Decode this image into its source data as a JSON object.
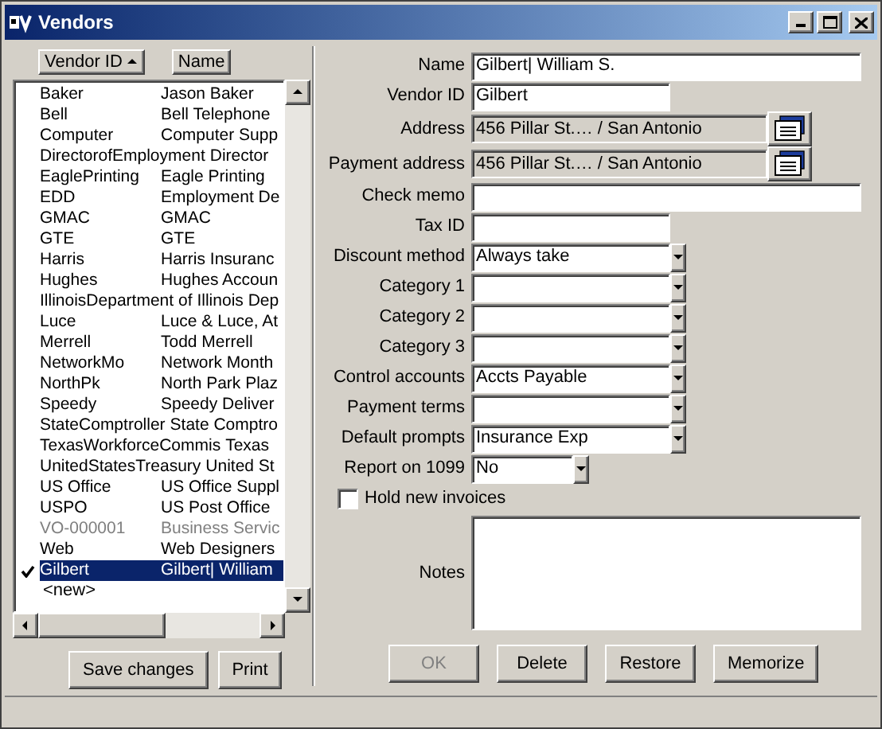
{
  "window": {
    "title": "Vendors"
  },
  "columns": [
    {
      "label": "Vendor ID",
      "sorted": true
    },
    {
      "label": "Name",
      "sorted": false
    }
  ],
  "vendors": [
    {
      "id": "Baker",
      "name": "Jason Baker",
      "inactive": false,
      "selected": false
    },
    {
      "id": "Bell",
      "name": "Bell Telephone",
      "inactive": false,
      "selected": false
    },
    {
      "id": "Computer",
      "name": "Computer Supp",
      "inactive": false,
      "selected": false
    },
    {
      "id": "DirectorofEmployment",
      "name": "Director",
      "inactive": false,
      "selected": false
    },
    {
      "id": "EaglePrinting",
      "name": "Eagle Printing",
      "inactive": false,
      "selected": false
    },
    {
      "id": "EDD",
      "name": "Employment De",
      "inactive": false,
      "selected": false
    },
    {
      "id": "GMAC",
      "name": "GMAC",
      "inactive": false,
      "selected": false
    },
    {
      "id": "GTE",
      "name": "GTE",
      "inactive": false,
      "selected": false
    },
    {
      "id": "Harris",
      "name": "Harris Insuranc",
      "inactive": false,
      "selected": false
    },
    {
      "id": "Hughes",
      "name": "Hughes Accoun",
      "inactive": false,
      "selected": false
    },
    {
      "id": "IllinoisDepartment",
      "name": "of Illinois Dep",
      "inactive": false,
      "selected": false
    },
    {
      "id": "Luce",
      "name": "Luce & Luce, At",
      "inactive": false,
      "selected": false
    },
    {
      "id": "Merrell",
      "name": "Todd Merrell",
      "inactive": false,
      "selected": false
    },
    {
      "id": "NetworkMo",
      "name": "Network Month",
      "inactive": false,
      "selected": false
    },
    {
      "id": "NorthPk",
      "name": "North Park Plaz",
      "inactive": false,
      "selected": false
    },
    {
      "id": "Speedy",
      "name": "Speedy Deliver",
      "inactive": false,
      "selected": false
    },
    {
      "id": "StateComptroller",
      "name": "State Comptro",
      "inactive": false,
      "selected": false
    },
    {
      "id": "TexasWorkforceCommis",
      "name": "Texas",
      "inactive": false,
      "selected": false
    },
    {
      "id": "UnitedStatesTreasury",
      "name": "United St",
      "inactive": false,
      "selected": false
    },
    {
      "id": "US Office",
      "name": "US Office Suppl",
      "inactive": false,
      "selected": false
    },
    {
      "id": "USPO",
      "name": "US Post Office",
      "inactive": false,
      "selected": false
    },
    {
      "id": "VO-000001",
      "name": "Business Servic",
      "inactive": true,
      "selected": false
    },
    {
      "id": "Web",
      "name": "Web Designers",
      "inactive": false,
      "selected": false
    },
    {
      "id": "Gilbert",
      "name": "Gilbert| William",
      "inactive": false,
      "selected": true
    }
  ],
  "new_entry": "<new>",
  "left_buttons": [
    {
      "label": "Save changes",
      "disabled": false
    },
    {
      "label": "Print",
      "disabled": false
    }
  ],
  "fields": [
    {
      "label": "Name",
      "kind": "wide",
      "value": "Gilbert| William S."
    },
    {
      "label": "Vendor ID",
      "kind": "narrow",
      "value": "Gilbert"
    },
    {
      "label": "Address",
      "kind": "address",
      "value": "456 Pillar St.… / San Antonio"
    },
    {
      "label": "Payment address",
      "kind": "address",
      "value": "456 Pillar St.… / San Antonio"
    },
    {
      "label": "Check memo",
      "kind": "wide"
    },
    {
      "label": "Tax ID",
      "kind": "narrow"
    },
    {
      "label": "Discount method",
      "kind": "combo",
      "value": "Always take"
    },
    {
      "label": "Category 1",
      "kind": "combo"
    },
    {
      "label": "Category 2",
      "kind": "combo"
    },
    {
      "label": "Category 3",
      "kind": "combo"
    },
    {
      "label": "Control accounts",
      "kind": "combo",
      "value": "Accts Payable"
    },
    {
      "label": "Payment terms",
      "kind": "combo"
    },
    {
      "label": "Default prompts",
      "kind": "combo",
      "value": "Insurance Exp"
    },
    {
      "label": "Report on 1099",
      "kind": "smallcombo",
      "value": "No"
    }
  ],
  "hold_invoices": {
    "label": "Hold new invoices",
    "checked": false
  },
  "notes": {
    "label": "Notes"
  },
  "buttons": [
    {
      "label": "OK",
      "disabled": true
    },
    {
      "label": "Delete",
      "disabled": false
    },
    {
      "label": "Restore",
      "disabled": false
    },
    {
      "label": "Memorize",
      "disabled": false
    }
  ]
}
